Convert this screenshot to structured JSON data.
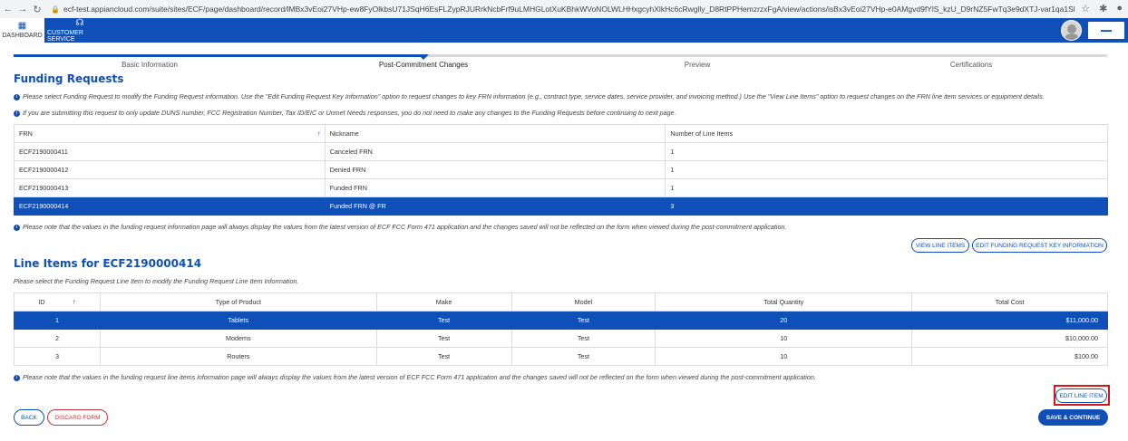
{
  "browser": {
    "url": "ecf-test.appiancloud.com/suite/sites/ECF/page/dashboard/record/lMBx3vEoi27VHp-ew8FyOlkbsU71JSqH6EsFLZypRJURrkNcbFrf9uLMHGLotXuKBhkWVoNOLWLHHxgcyhXlkHc6cRwglly_D8RtPPHemzrzxFgA/view/actions/isBx3vEoi27VHp-e0AMgvd9fYlS_kzU_D9rNZ5FwTq3e9dXTJ-var1qa1Sl"
  },
  "header": {
    "tabs": [
      {
        "label": "DASHBOARD"
      },
      {
        "label": "CUSTOMER SERVICE"
      }
    ]
  },
  "stepper": {
    "steps": [
      {
        "label": "Basic Information"
      },
      {
        "label": "Post-Commitment Changes"
      },
      {
        "label": "Preview"
      },
      {
        "label": "Certifications"
      }
    ]
  },
  "funding_requests": {
    "title": "Funding Requests",
    "info_1": "Please select Funding Request to modify the Funding Request information. Use the \"Edit Funding Request Key Information\" option to request changes to key FRN information (e.g., contract type, service dates, service provider, and invoicing method.) Use the \"View Line Items\" option to request changes on the FRN line item services or equipment details.",
    "info_2": "If you are submitting this request to only update DUNS number, FCC Registration Number, Tax ID/EIC or Unmet Needs responses, you do not need to make any changes to the Funding Requests before continuing to next page.",
    "columns": [
      "FRN",
      "Nickname",
      "Number of Line Items"
    ],
    "rows": [
      [
        "ECF2190000411",
        "Canceled FRN",
        "1"
      ],
      [
        "ECF2190000412",
        "Denied FRN",
        "1"
      ],
      [
        "ECF2190000413",
        "Funded FRN",
        "1"
      ],
      [
        "ECF2190000414",
        "Funded FRN @ FR",
        "3"
      ]
    ],
    "note": "Please note that the values in the funding request information page will always display the values from the latest version of ECF FCC Form 471 application and the changes saved will not be reflected on the form when viewed during the post-commitment application.",
    "view_line_items": "VIEW LINE ITEMS",
    "edit_key_info": "EDIT FUNDING REQUEST KEY INFORMATION"
  },
  "line_items": {
    "title": "Line Items for ECF2190000414",
    "instruction": "Please select the Funding Request Line Item to modify the Funding Request Line Item Information.",
    "columns": [
      "ID",
      "Type of Product",
      "Make",
      "Model",
      "Total Quantity",
      "Total Cost"
    ],
    "rows": [
      [
        "1",
        "Tablets",
        "Test",
        "Test",
        "20",
        "$11,000.00"
      ],
      [
        "2",
        "Modems",
        "Test",
        "Test",
        "10",
        "$10,000.00"
      ],
      [
        "3",
        "Routers",
        "Test",
        "Test",
        "10",
        "$100.00"
      ]
    ],
    "note": "Please note that the values in the funding request line items information page will always display the values from the latest version of ECF FCC Form 471 application and the changes saved will not be reflected on the form when viewed during the post-commitment application.",
    "edit_line_item": "EDIT LINE ITEM"
  },
  "footer": {
    "back": "BACK",
    "discard": "DISCARD FORM",
    "save_continue": "SAVE & CONTINUE"
  },
  "colors": {
    "primary": "#0f4fb8",
    "danger": "#c8333a",
    "highlight": "#d11a1a"
  }
}
